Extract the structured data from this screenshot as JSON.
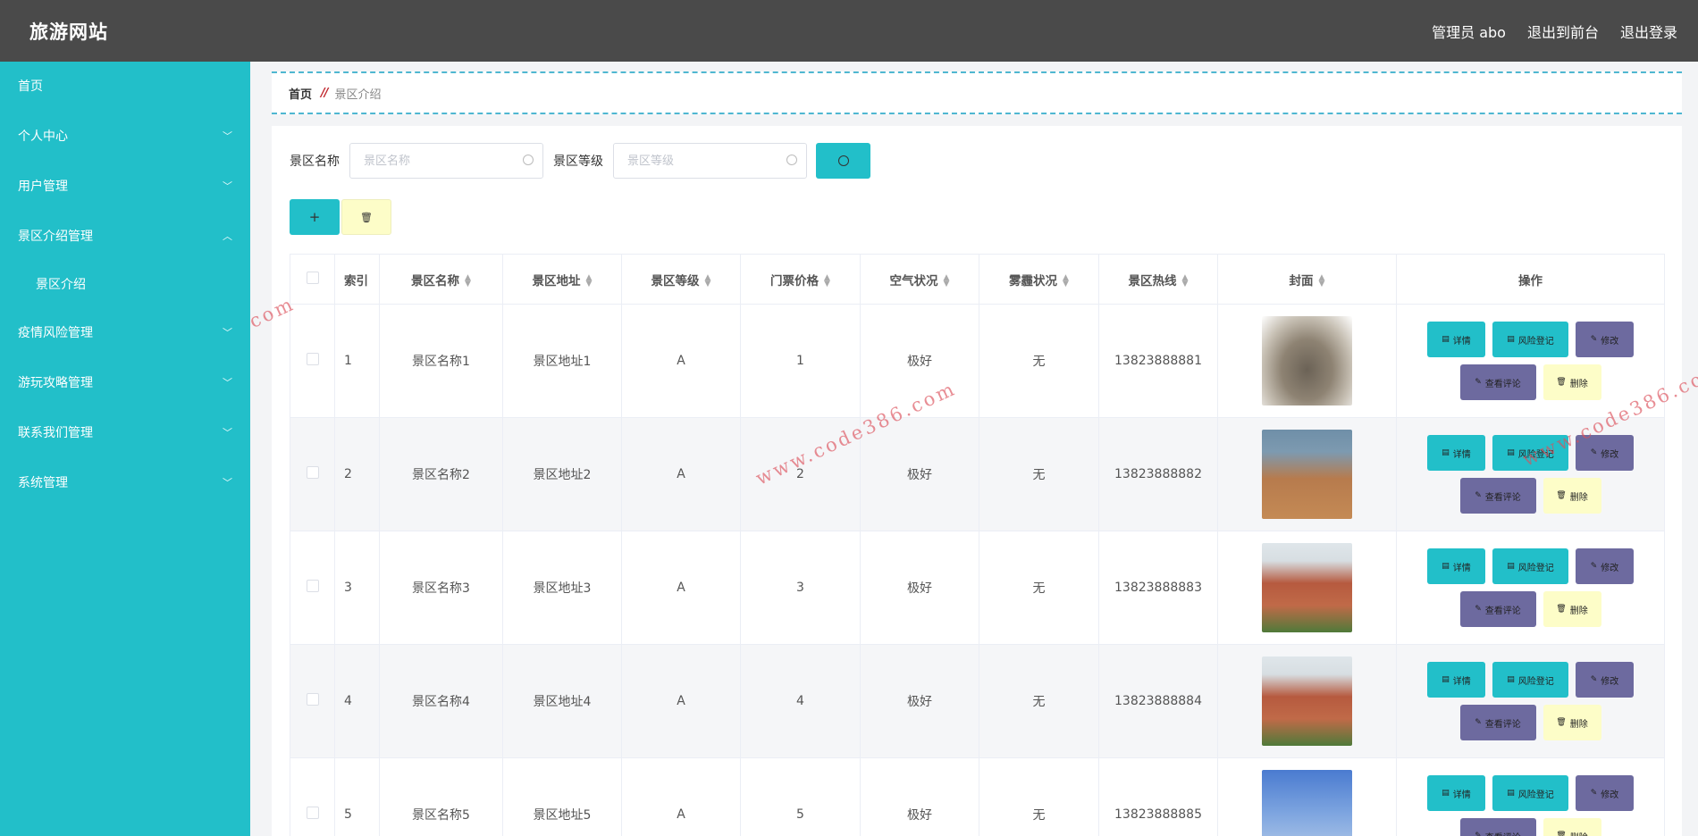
{
  "header": {
    "brand": "旅游网站",
    "admin": "管理员 abo",
    "to_front": "退出到前台",
    "logout": "退出登录"
  },
  "sidebar": {
    "items": [
      {
        "label": "首页",
        "chevron": ""
      },
      {
        "label": "个人中心",
        "chevron": "down"
      },
      {
        "label": "用户管理",
        "chevron": "down"
      },
      {
        "label": "景区介绍管理",
        "chevron": "up"
      },
      {
        "label": "景区介绍",
        "chevron": "",
        "sub": true
      },
      {
        "label": "疫情风险管理",
        "chevron": "down"
      },
      {
        "label": "游玩攻略管理",
        "chevron": "down"
      },
      {
        "label": "联系我们管理",
        "chevron": "down"
      },
      {
        "label": "系统管理",
        "chevron": "down"
      }
    ]
  },
  "breadcrumb": {
    "home": "首页",
    "separator": "//",
    "current": "景区介绍"
  },
  "search": {
    "name_label": "景区名称",
    "name_placeholder": "景区名称",
    "level_label": "景区等级",
    "level_placeholder": "景区等级"
  },
  "actions": {
    "add_label": "+"
  },
  "table": {
    "columns": [
      "索引",
      "景区名称",
      "景区地址",
      "景区等级",
      "门票价格",
      "空气状况",
      "雾霾状况",
      "景区热线",
      "封面",
      "操作"
    ],
    "rows": [
      {
        "index": "1",
        "name": "景区名称1",
        "address": "景区地址1",
        "level": "A",
        "price": "1",
        "air": "极好",
        "haze": "无",
        "hotline": "13823888881"
      },
      {
        "index": "2",
        "name": "景区名称2",
        "address": "景区地址2",
        "level": "A",
        "price": "2",
        "air": "极好",
        "haze": "无",
        "hotline": "13823888882"
      },
      {
        "index": "3",
        "name": "景区名称3",
        "address": "景区地址3",
        "level": "A",
        "price": "3",
        "air": "极好",
        "haze": "无",
        "hotline": "13823888883"
      },
      {
        "index": "4",
        "name": "景区名称4",
        "address": "景区地址4",
        "level": "A",
        "price": "4",
        "air": "极好",
        "haze": "无",
        "hotline": "13823888884"
      },
      {
        "index": "5",
        "name": "景区名称5",
        "address": "景区地址5",
        "level": "A",
        "price": "5",
        "air": "极好",
        "haze": "无",
        "hotline": "13823888885"
      }
    ],
    "ops": {
      "detail": "详情",
      "risk": "风险登记",
      "edit": "修改",
      "comment": "查看评论",
      "delete": "删除"
    }
  },
  "watermark": "www.code386.com",
  "colors": {
    "topbar": "#4a4a4a",
    "accent": "#22bfc9",
    "purple": "#6d6a9f",
    "delete_yellow": "#fdfdc8"
  }
}
